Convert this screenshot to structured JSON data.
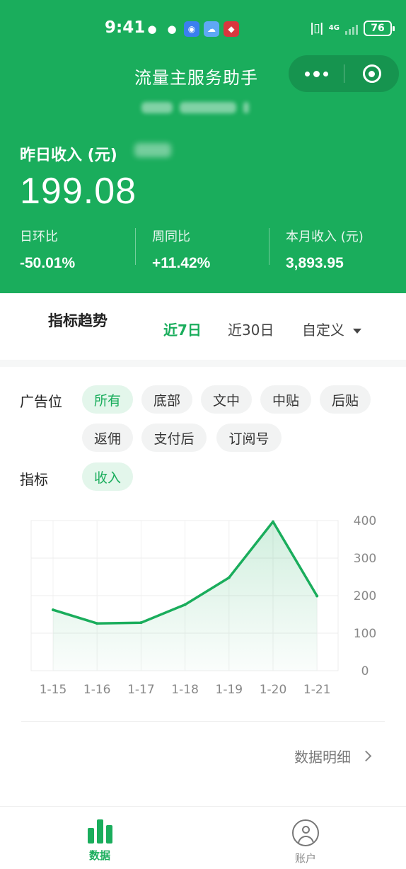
{
  "status_bar": {
    "time": "9:41",
    "network": "4G",
    "battery": "76"
  },
  "header": {
    "title": "流量主服务助手",
    "yesterday_label": "昨日收入 (元)",
    "yesterday_value": "199.08",
    "stats": [
      {
        "label": "日环比",
        "value": "-50.01%"
      },
      {
        "label": "周同比",
        "value": "+11.42%"
      },
      {
        "label": "本月收入 (元)",
        "value": "3,893.95"
      }
    ]
  },
  "trend": {
    "title": "指标趋势",
    "ranges": [
      "近7日",
      "近30日",
      "自定义"
    ],
    "active_range": "近7日"
  },
  "filters": {
    "ad_position_label": "广告位",
    "ad_positions": [
      "所有",
      "底部",
      "文中",
      "中贴",
      "后贴",
      "返佣",
      "支付后",
      "订阅号"
    ],
    "metric_label": "指标",
    "metrics": [
      "收入"
    ]
  },
  "chart_data": {
    "type": "area",
    "categories": [
      "1-15",
      "1-16",
      "1-17",
      "1-18",
      "1-19",
      "1-20",
      "1-21"
    ],
    "series": [
      {
        "values": [
          162,
          126,
          128,
          176,
          248,
          397,
          199
        ]
      }
    ],
    "ylim": [
      0,
      400
    ],
    "yticks": [
      0,
      100,
      200,
      300,
      400
    ],
    "grid": true,
    "y_axis_side": "right",
    "color": "#1aad5c"
  },
  "footer": {
    "detail_link": "数据明细"
  },
  "tabbar": {
    "items": [
      "数据",
      "账户"
    ],
    "active": "数据"
  },
  "colors": {
    "brand_green": "#1aad5c",
    "chip_active_bg": "#e3f6eb"
  }
}
